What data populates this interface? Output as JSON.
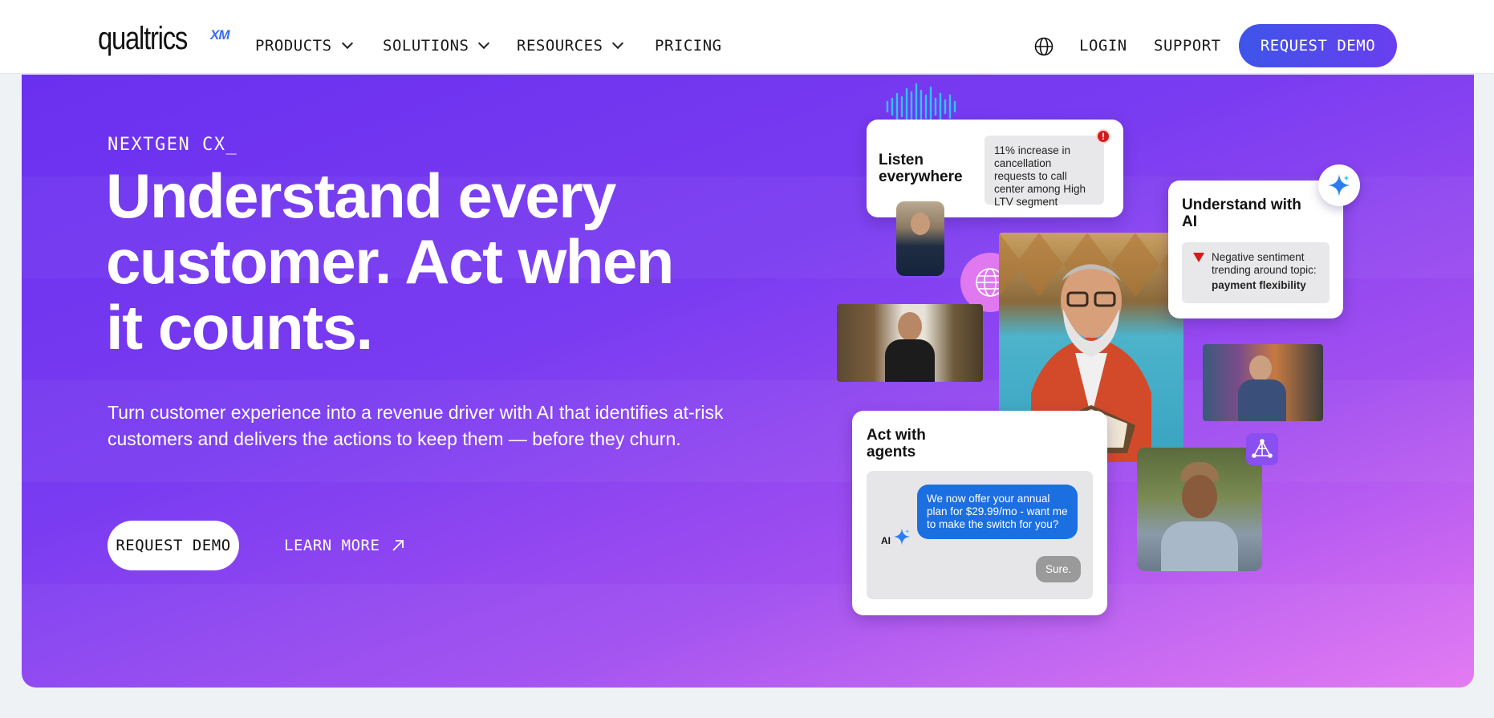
{
  "nav": {
    "logo": "qualtrics",
    "logo_mark": "XM",
    "items": [
      {
        "label": "PRODUCTS"
      },
      {
        "label": "SOLUTIONS"
      },
      {
        "label": "RESOURCES"
      },
      {
        "label": "PRICING"
      }
    ],
    "login": "LOGIN",
    "support": "SUPPORT",
    "request_demo": "REQUEST DEMO"
  },
  "hero": {
    "eyebrow": "NEXTGEN CX_",
    "headline": "Understand every customer. Act when it counts.",
    "subtext": "Turn customer experience into a revenue driver with AI that identifies at-risk customers and delivers the actions to keep them — before they churn.",
    "cta_primary": "REQUEST DEMO",
    "cta_secondary": "LEARN MORE"
  },
  "collage": {
    "listen": {
      "title": "Listen everywhere",
      "alert_text": "11% increase in cancellation requests to call center among High LTV segment",
      "alert_badge": "!"
    },
    "understand": {
      "title": "Understand with AI",
      "insight_text": "Negative sentiment trending around topic:",
      "insight_topic": "payment flexibility"
    },
    "act": {
      "title": "Act with agents",
      "ai_label": "AI",
      "agent_message": "We now offer your annual plan for $29.99/mo - want me to make the switch for you?",
      "customer_reply": "Sure."
    }
  },
  "colors": {
    "brand_blue": "#3b6cf0",
    "hero_start": "#6a30ef",
    "hero_end": "#e276f2",
    "agent_bubble": "#1b6fe0"
  }
}
